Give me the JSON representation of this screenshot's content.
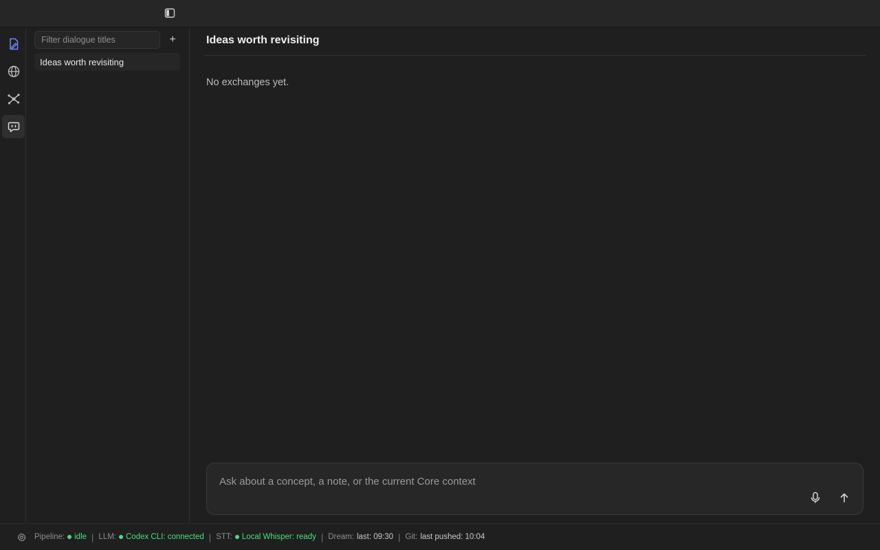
{
  "sidebar": {
    "filter_placeholder": "Filter dialogue titles",
    "add_label": "+",
    "dialogues": [
      {
        "title": "Ideas worth revisiting",
        "selected": true
      }
    ]
  },
  "activity_bar": {
    "items": [
      {
        "icon": "edit-note-icon",
        "accent": true
      },
      {
        "icon": "globe-icon"
      },
      {
        "icon": "graph-network-icon"
      },
      {
        "icon": "chat-bot-icon",
        "active": true
      }
    ]
  },
  "main": {
    "title": "Ideas worth revisiting",
    "empty_text": "No exchanges yet."
  },
  "composer": {
    "placeholder": "Ask about a concept, a note, or the current Core context",
    "mic_icon": "microphone-icon",
    "send_icon": "arrow-up-icon"
  },
  "status": {
    "pipeline_label": "Pipeline:",
    "pipeline_value": "idle",
    "llm_label": "LLM:",
    "llm_value": "Codex CLI: connected",
    "stt_label": "STT:",
    "stt_value": "Local Whisper: ready",
    "dream_label": "Dream:",
    "dream_value": "last: 09:30",
    "git_label": "Git:",
    "git_value": "last pushed: 10:04",
    "separator": "|"
  },
  "colors": {
    "background": "#1f1f1f",
    "accent_blue": "#6b8cff",
    "status_green": "#4ade80"
  }
}
